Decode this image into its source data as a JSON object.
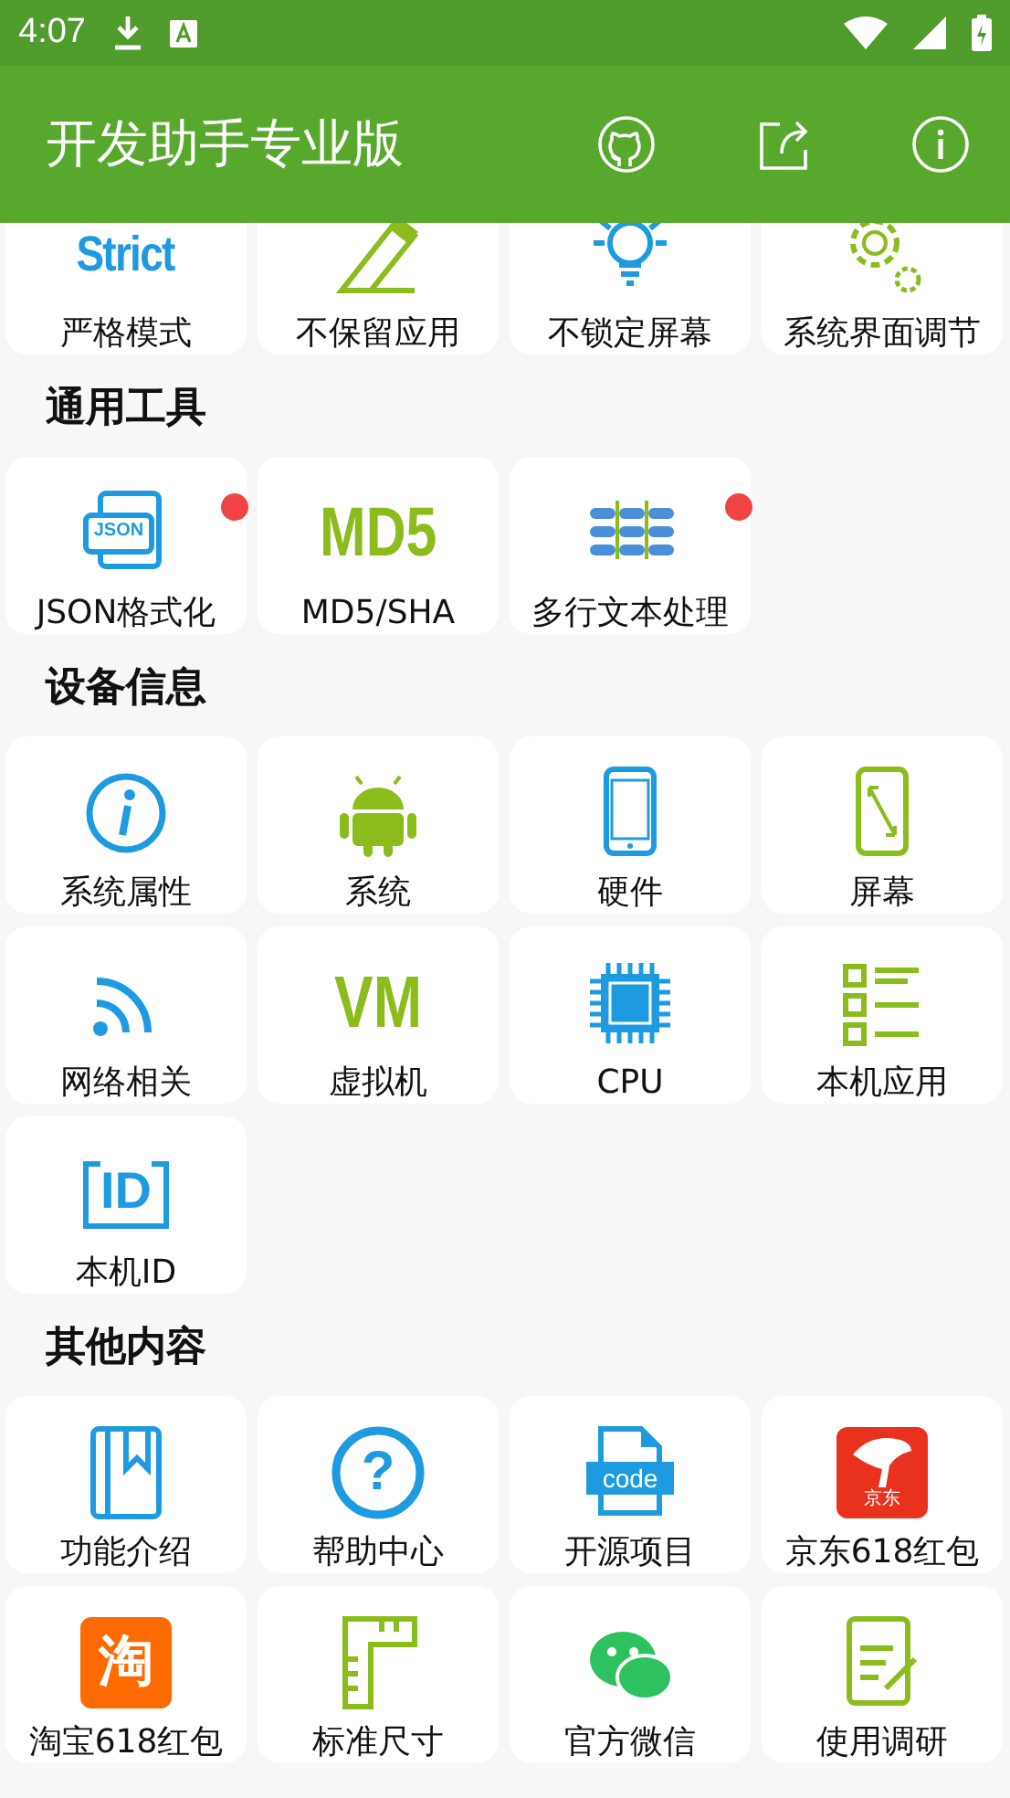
{
  "status_bar": {
    "time": "4:07"
  },
  "app_bar": {
    "title": "开发助手专业版"
  },
  "sections": [
    {
      "tiles": [
        {
          "label": "严格模式",
          "kind": "strict",
          "glyph": "Strict",
          "dot": false
        },
        {
          "label": "不保留应用",
          "kind": "eraser",
          "dot": false
        },
        {
          "label": "不锁定屏幕",
          "kind": "bulb",
          "dot": false
        },
        {
          "label": "系统界面调节",
          "kind": "gears",
          "dot": false
        }
      ]
    },
    {
      "title": "通用工具",
      "tiles": [
        {
          "label": "JSON格式化",
          "kind": "json",
          "glyph": "JSON",
          "dot": true
        },
        {
          "label": "MD5/SHA",
          "kind": "md5",
          "glyph": "MD5",
          "dot": false
        },
        {
          "label": "多行文本处理",
          "kind": "lines",
          "dot": true
        }
      ]
    },
    {
      "title": "设备信息",
      "tiles": [
        {
          "label": "系统属性",
          "kind": "info",
          "dot": false
        },
        {
          "label": "系统",
          "kind": "android",
          "dot": false
        },
        {
          "label": "硬件",
          "kind": "phone",
          "dot": false
        },
        {
          "label": "屏幕",
          "kind": "screen",
          "dot": false
        },
        {
          "label": "网络相关",
          "kind": "wifi",
          "dot": false
        },
        {
          "label": "虚拟机",
          "kind": "vm",
          "glyph": "VM",
          "dot": false
        },
        {
          "label": "CPU",
          "kind": "cpu",
          "dot": false
        },
        {
          "label": "本机应用",
          "kind": "list",
          "dot": false
        },
        {
          "label": "本机ID",
          "kind": "id",
          "glyph": "ID",
          "dot": false
        }
      ]
    },
    {
      "title": "其他内容",
      "tiles": [
        {
          "label": "功能介绍",
          "kind": "book",
          "dot": false
        },
        {
          "label": "帮助中心",
          "kind": "help",
          "glyph": "?",
          "dot": false
        },
        {
          "label": "开源项目",
          "kind": "code",
          "glyph": "code",
          "dot": false
        },
        {
          "label": "京东618红包",
          "kind": "jd",
          "glyph": "京东",
          "dot": false
        },
        {
          "label": "淘宝618红包",
          "kind": "taobao",
          "glyph": "淘",
          "dot": false
        },
        {
          "label": "标准尺寸",
          "kind": "ruler",
          "dot": false
        },
        {
          "label": "官方微信",
          "kind": "wechat",
          "dot": false
        },
        {
          "label": "使用调研",
          "kind": "survey",
          "dot": false
        }
      ]
    }
  ]
}
